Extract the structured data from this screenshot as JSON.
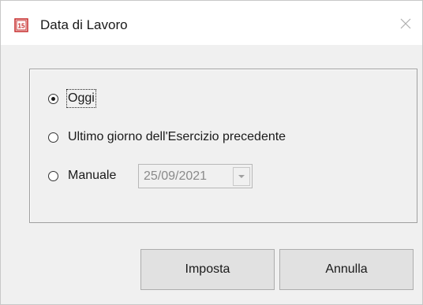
{
  "window": {
    "title": "Data di Lavoro",
    "icon": "app-calendar-icon",
    "close_icon": "close-icon"
  },
  "options": [
    {
      "label": "Oggi",
      "checked": true,
      "focused": true
    },
    {
      "label": "Ultimo giorno dell'Esercizio precedente",
      "checked": false,
      "focused": false
    },
    {
      "label": "Manuale",
      "checked": false,
      "focused": false
    }
  ],
  "manual_date": {
    "value": "25/09/2021",
    "enabled": false
  },
  "buttons": {
    "set_label": "Imposta",
    "cancel_label": "Annulla"
  },
  "colors": {
    "window_bg": "#f0f0f0",
    "titlebar_bg": "#ffffff",
    "icon_accent": "#c62828"
  }
}
